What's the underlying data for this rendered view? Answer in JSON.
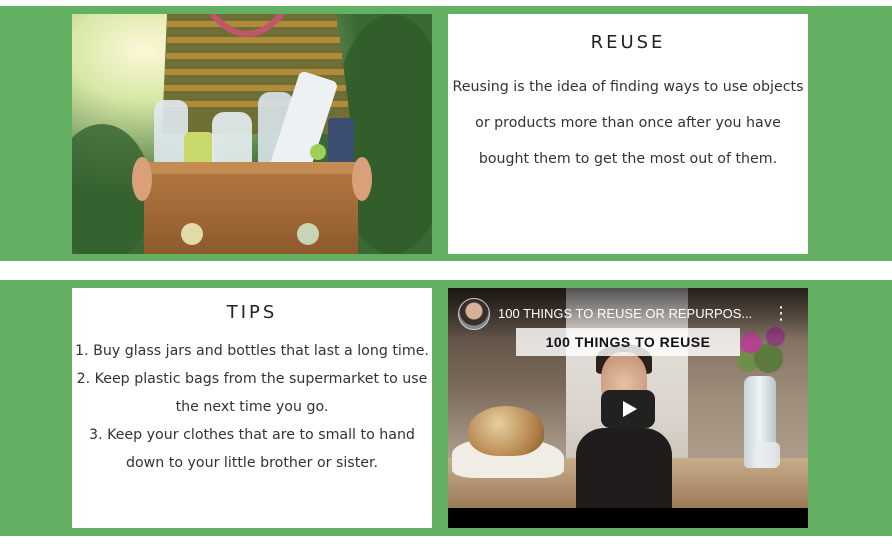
{
  "reuse": {
    "title": "REUSE",
    "body": "Reusing is the idea of finding ways to use objects or products more than once after you have bought them to get the most out of them."
  },
  "tips": {
    "title": "TIPS",
    "items": [
      "1. Buy glass jars and bottles that last a long time.",
      "2. Keep plastic bags from the supermarket to use the next time you go.",
      "3. Keep your clothes that are to small to hand down to your little brother or sister."
    ]
  },
  "video": {
    "title": "100 THINGS TO REUSE OR REPURPOS...",
    "banner": "100 THINGS TO REUSE",
    "menu_icon": "more-vert-icon",
    "play_icon": "play-icon"
  },
  "colors": {
    "band_green": "#63b062",
    "card_white": "#ffffff"
  }
}
